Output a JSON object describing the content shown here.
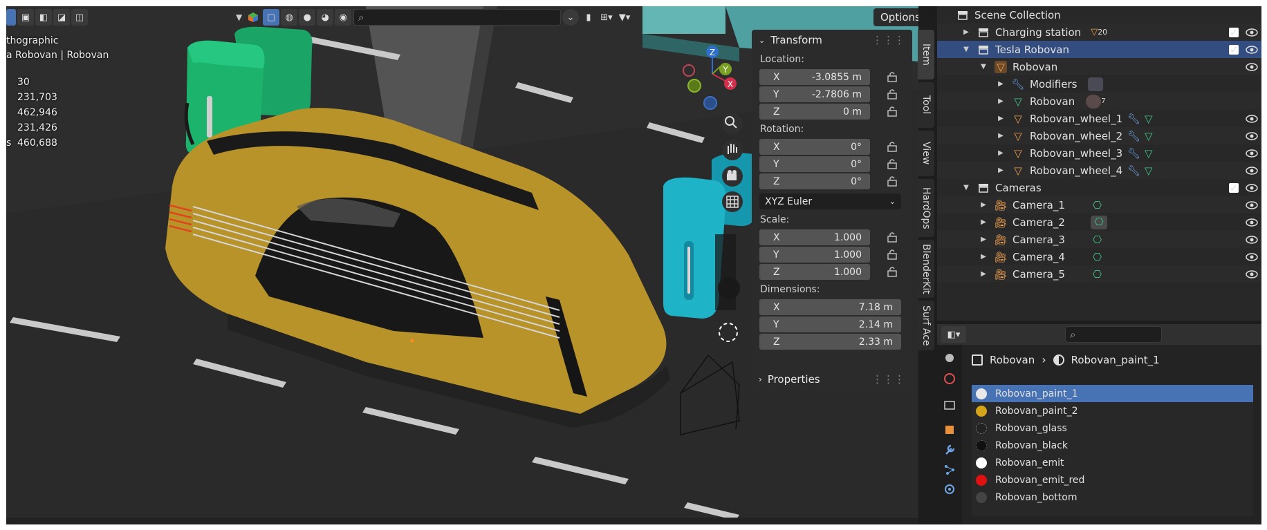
{
  "viewport": {
    "overlay": {
      "mode": "thographic",
      "object": "a Robovan | Robovan",
      "stats": [
        "30",
        "231,703",
        "462,946",
        "231,426",
        "460,688"
      ],
      "stats_prefix": "s"
    },
    "header": {
      "options_label": "Options"
    },
    "side_tabs": [
      "Item",
      "Tool",
      "View",
      "HardOps",
      "BlenderKit",
      "Surf Ace"
    ]
  },
  "npanel": {
    "transform_title": "Transform",
    "location_label": "Location:",
    "location": [
      {
        "axis": "X",
        "value": "-3.0855 m"
      },
      {
        "axis": "Y",
        "value": "-2.7806 m"
      },
      {
        "axis": "Z",
        "value": "0 m"
      }
    ],
    "rotation_label": "Rotation:",
    "rotation": [
      {
        "axis": "X",
        "value": "0°"
      },
      {
        "axis": "Y",
        "value": "0°"
      },
      {
        "axis": "Z",
        "value": "0°"
      }
    ],
    "rotation_mode": "XYZ Euler",
    "scale_label": "Scale:",
    "scale": [
      {
        "axis": "X",
        "value": "1.000"
      },
      {
        "axis": "Y",
        "value": "1.000"
      },
      {
        "axis": "Z",
        "value": "1.000"
      }
    ],
    "dimensions_label": "Dimensions:",
    "dimensions": [
      {
        "axis": "X",
        "value": "7.18 m"
      },
      {
        "axis": "Y",
        "value": "2.14 m"
      },
      {
        "axis": "Z",
        "value": "2.33 m"
      }
    ],
    "properties_title": "Properties"
  },
  "outliner": {
    "scene_collection": "Scene Collection",
    "rows": [
      {
        "label": "Charging station",
        "badge": "20"
      },
      {
        "label": "Tesla Robovan"
      },
      {
        "label": "Robovan"
      },
      {
        "label": "Modifiers"
      },
      {
        "label": "Robovan",
        "badge": "7"
      },
      {
        "label": "Robovan_wheel_1"
      },
      {
        "label": "Robovan_wheel_2"
      },
      {
        "label": "Robovan_wheel_3"
      },
      {
        "label": "Robovan_wheel_4"
      },
      {
        "label": "Cameras"
      },
      {
        "label": "Camera_1"
      },
      {
        "label": "Camera_2"
      },
      {
        "label": "Camera_3"
      },
      {
        "label": "Camera_4"
      },
      {
        "label": "Camera_5"
      }
    ]
  },
  "properties": {
    "breadcrumb_object": "Robovan",
    "breadcrumb_material": "Robovan_paint_1",
    "materials": [
      {
        "name": "Robovan_paint_1",
        "color": "#e8e8e8"
      },
      {
        "name": "Robovan_paint_2",
        "color": "#d4a51a"
      },
      {
        "name": "Robovan_glass",
        "color": "#222222"
      },
      {
        "name": "Robovan_black",
        "color": "#111111"
      },
      {
        "name": "Robovan_emit",
        "color": "#ffffff"
      },
      {
        "name": "Robovan_emit_red",
        "color": "#e01010"
      },
      {
        "name": "Robovan_bottom",
        "color": "#444444"
      }
    ]
  },
  "colors": {
    "selection": "#4772b3",
    "outliner_selection": "#334d80",
    "van_paint": "#b8932a",
    "charger_green": "#18a060",
    "charger_cyan": "#1fb3c8"
  }
}
